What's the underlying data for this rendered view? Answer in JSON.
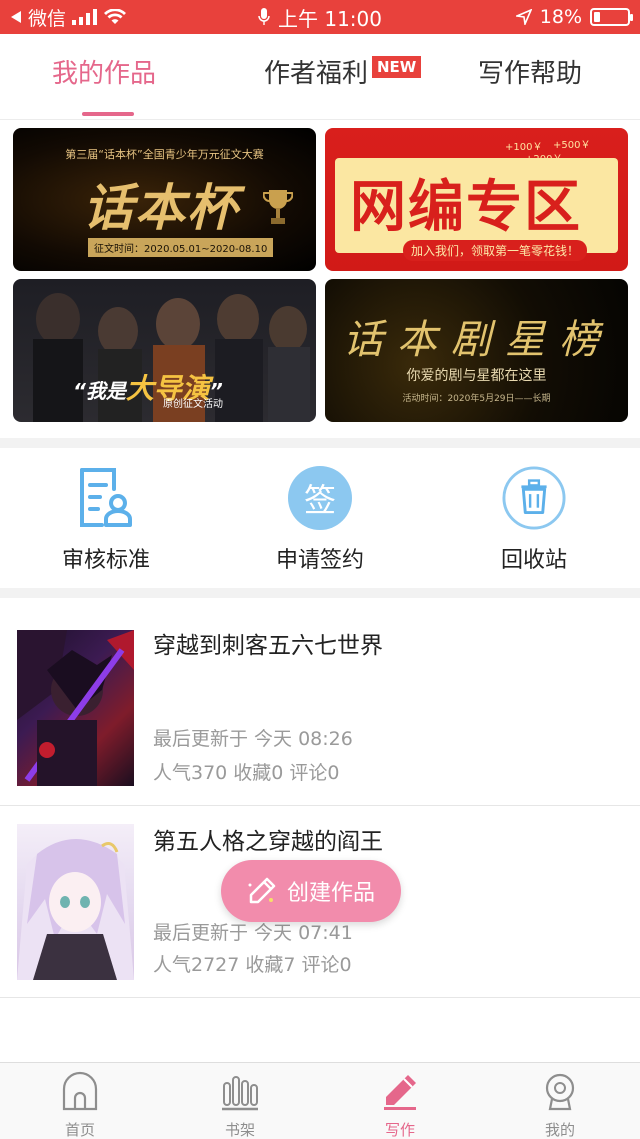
{
  "status_bar": {
    "carrier": "微信",
    "time": "上午 11:00",
    "battery_percent": "18%",
    "battery_level": 0.18
  },
  "tabs": [
    {
      "label": "我的作品",
      "active": true
    },
    {
      "label": "作者福利",
      "badge": "NEW"
    },
    {
      "label": "写作帮助"
    }
  ],
  "banners": [
    {
      "title": "话本杯",
      "subtitle": "第三届“话本杯”全国青少年万元征文大赛",
      "date": "征文时间：2020.05.01~2020-08.10"
    },
    {
      "title": "网编专区",
      "tagline": "加入我们，领取第一笔零花钱！",
      "coins": [
        "+100￥",
        "+500￥",
        "+200￥"
      ]
    },
    {
      "title_prefix": "“我是",
      "title_highlight": "大导演",
      "title_suffix": "”",
      "subtitle": "原创征文活动"
    },
    {
      "title": "话本剧星榜",
      "subtitle": "你爱的剧与星都在这里",
      "date": "活动时间：2020年5月29日——长期"
    }
  ],
  "shortcuts": [
    {
      "label": "审核标准",
      "icon": "review-document-icon"
    },
    {
      "label": "申请签约",
      "icon_text": "签",
      "icon": "sign-contract-icon"
    },
    {
      "label": "回收站",
      "icon": "trash-icon"
    }
  ],
  "works": [
    {
      "title": "穿越到刺客五六七世界",
      "updated": "最后更新于 今天 08:26",
      "stats": "人气370 收藏0 评论0"
    },
    {
      "title": "第五人格之穿越的阎王",
      "updated": "最后更新于 今天 07:41",
      "stats": "人气2727 收藏7 评论0"
    }
  ],
  "fab": {
    "label": "创建作品"
  },
  "bottom_nav": [
    {
      "label": "首页",
      "icon": "home-icon"
    },
    {
      "label": "书架",
      "icon": "bookshelf-icon"
    },
    {
      "label": "写作",
      "icon": "pen-icon",
      "active": true
    },
    {
      "label": "我的",
      "icon": "profile-icon"
    }
  ],
  "colors": {
    "status_bar": "#e8413c",
    "accent": "#e5678b",
    "fab": "#f28cac",
    "shortcut_blue": "#5cb0ea"
  }
}
